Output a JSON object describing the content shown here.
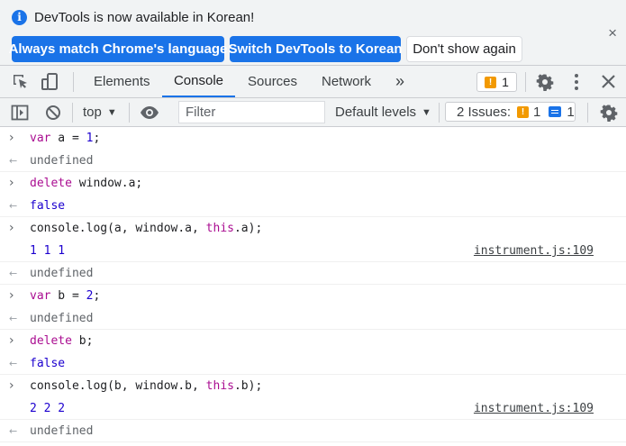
{
  "infobar": {
    "message": "DevTools is now available in Korean!",
    "buttons": [
      "Always match Chrome's language",
      "Switch DevTools to Korean",
      "Don't show again"
    ],
    "close_glyph": "×"
  },
  "main_toolbar": {
    "tabs": [
      "Elements",
      "Console",
      "Sources",
      "Network"
    ],
    "active_tab": "Console",
    "more_tabs_glyph": "»",
    "warning_count": "1"
  },
  "console_toolbar": {
    "context": "top",
    "filter_placeholder": "Filter",
    "levels": "Default levels",
    "issues_label": "2 Issues:",
    "issues_warning": "1",
    "issues_info": "1"
  },
  "console": {
    "lines": [
      {
        "kind": "input",
        "segments": [
          {
            "t": "var",
            "c": "kw"
          },
          {
            "t": " a = ",
            "c": "plain"
          },
          {
            "t": "1",
            "c": "num"
          },
          {
            "t": ";",
            "c": "plain"
          }
        ]
      },
      {
        "kind": "result",
        "segments": [
          {
            "t": "undefined",
            "c": "undef"
          }
        ]
      },
      {
        "kind": "input",
        "segments": [
          {
            "t": "delete",
            "c": "kw"
          },
          {
            "t": " window.a;",
            "c": "plain"
          }
        ]
      },
      {
        "kind": "result",
        "segments": [
          {
            "t": "false",
            "c": "num"
          }
        ]
      },
      {
        "kind": "input",
        "segments": [
          {
            "t": "console.log(a, window.a, ",
            "c": "plain"
          },
          {
            "t": "this",
            "c": "kw"
          },
          {
            "t": ".a);",
            "c": "plain"
          }
        ]
      },
      {
        "kind": "log",
        "segments": [
          {
            "t": "1 1 1",
            "c": "num"
          }
        ],
        "source": "instrument.js:109"
      },
      {
        "kind": "result",
        "segments": [
          {
            "t": "undefined",
            "c": "undef"
          }
        ]
      },
      {
        "kind": "input",
        "segments": [
          {
            "t": "var",
            "c": "kw"
          },
          {
            "t": " b = ",
            "c": "plain"
          },
          {
            "t": "2",
            "c": "num"
          },
          {
            "t": ";",
            "c": "plain"
          }
        ]
      },
      {
        "kind": "result",
        "segments": [
          {
            "t": "undefined",
            "c": "undef"
          }
        ]
      },
      {
        "kind": "input",
        "segments": [
          {
            "t": "delete",
            "c": "kw"
          },
          {
            "t": " b;",
            "c": "plain"
          }
        ]
      },
      {
        "kind": "result",
        "segments": [
          {
            "t": "false",
            "c": "num"
          }
        ]
      },
      {
        "kind": "input",
        "segments": [
          {
            "t": "console.log(b, window.b, ",
            "c": "plain"
          },
          {
            "t": "this",
            "c": "kw"
          },
          {
            "t": ".b);",
            "c": "plain"
          }
        ]
      },
      {
        "kind": "log",
        "segments": [
          {
            "t": "2 2 2",
            "c": "num"
          }
        ],
        "source": "instrument.js:109"
      },
      {
        "kind": "result",
        "segments": [
          {
            "t": "undefined",
            "c": "undef"
          }
        ]
      }
    ]
  },
  "colors": {
    "accent": "#1a73e8",
    "warning": "#f29900",
    "keyword": "#aa0d91",
    "number": "#1c00cf"
  },
  "icons": [
    "info-icon",
    "inspect-element-icon",
    "device-toggle-icon",
    "more-tabs-icon",
    "warning-icon",
    "gear-icon",
    "kebab-menu-icon",
    "close-icon",
    "sidebar-toggle-icon",
    "clear-console-icon",
    "eye-icon",
    "message-icon",
    "input-chevron-icon",
    "result-arrow-icon"
  ]
}
